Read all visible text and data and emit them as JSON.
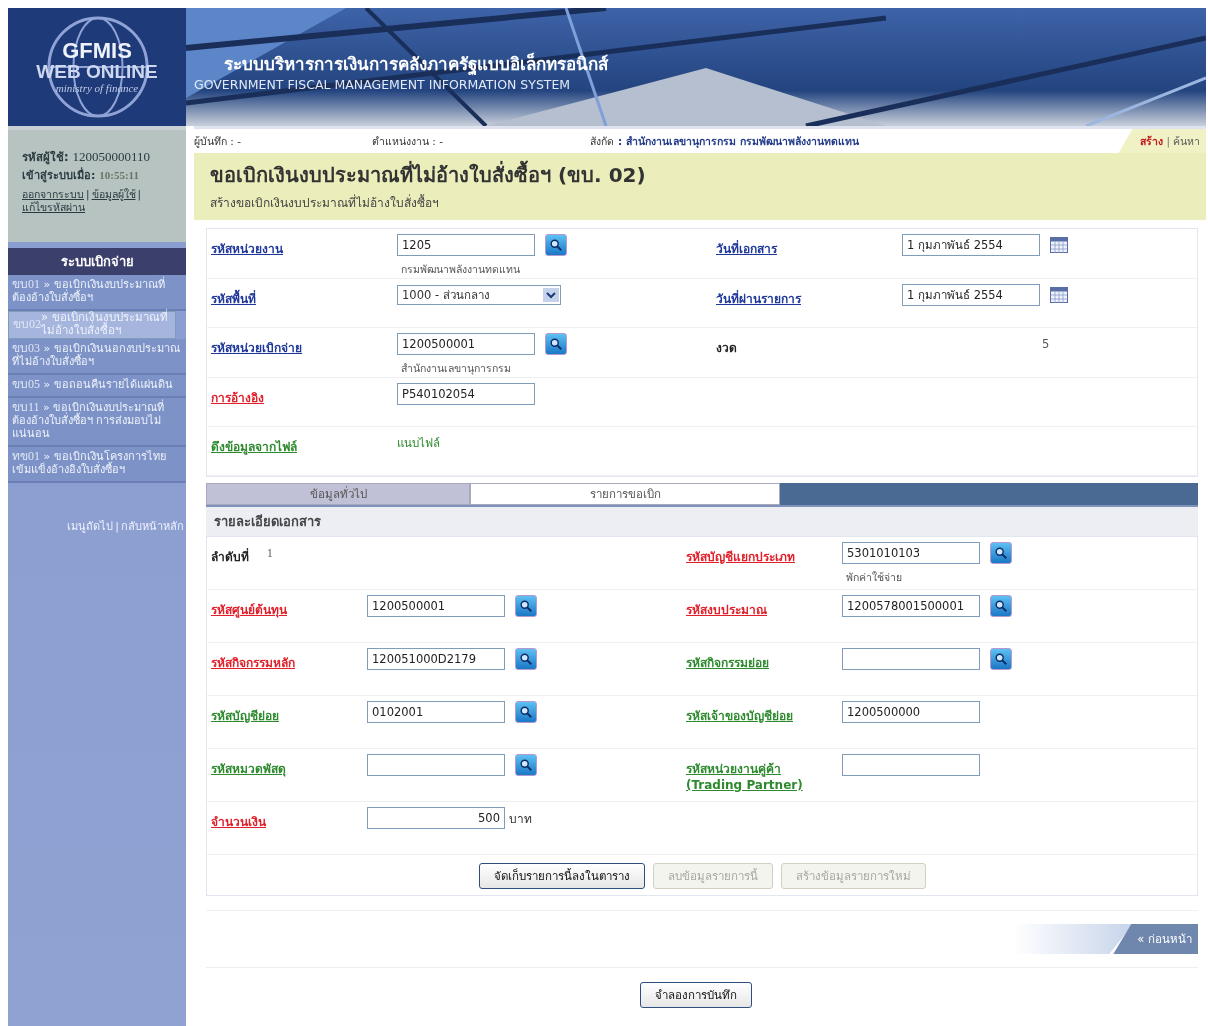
{
  "header": {
    "logo": {
      "line_1": "GFMIS",
      "line_2": "WEB ONLINE",
      "line_3": "ministry of finance"
    },
    "title": "ระบบบริหารการเงินการคลังภาครัฐแบบอิเล็กทรอนิกส์",
    "subtitle": "GOVERNMENT FISCAL MANAGEMENT INFORMATION SYSTEM"
  },
  "user_panel": {
    "user_id_label": "รหัสผู้ใช้:",
    "user_id": "120050000110",
    "login_label": "เข้าสู่ระบบเมื่อ:",
    "login_time": "10:55:11",
    "links": [
      "ออกจากระบบ",
      "ข้อมูลผู้ใช้",
      "แก้ไขรหัสผ่าน"
    ],
    "separator": "|"
  },
  "menu": {
    "title": "ระบบเบิกจ่าย",
    "items": [
      {
        "code": "ขบ01",
        "text": "» ขอเบิกเงินงบประมาณที่ต้องอ้างใบสั่งซื้อฯ",
        "selected": false
      },
      {
        "code": "ขบ02",
        "text": "» ขอเบิกเงินงบประมาณที่ไม่อ้างใบสั่งซื้อฯ",
        "selected": true
      },
      {
        "code": "ขบ03",
        "text": "» ขอเบิกเงินนอกงบประมาณที่ไม่อ้างใบสั่งซื้อฯ",
        "selected": false
      },
      {
        "code": "ขบ05",
        "text": "» ขอถอนคืนรายได้แผ่นดิน",
        "selected": false
      },
      {
        "code": "ขบ11",
        "text": "» ขอเบิกเงินงบประมาณที่ต้องอ้างใบสั่งซื้อฯ การส่งมอบไม่แน่นอน",
        "selected": false
      },
      {
        "code": "ทข01",
        "text": "» ขอเบิกเงินโครงการไทยเข้มแข็งอ้างอิงใบสั่งซื้อฯ",
        "selected": false
      }
    ],
    "footer": [
      "เมนูถัดไป",
      "กลับหน้าหลัก"
    ],
    "separator": "|"
  },
  "info_bar": {
    "recorder": "ผู้บันทึก : -",
    "position": "ตำแหน่งงาน : -",
    "affiliation_label": "สังกัด",
    "affiliation": ": สำนักงานเลขานุการกรม กรมพัฒนาพลังงานทดแทน",
    "modes": [
      {
        "label": "สร้าง",
        "selected": true
      },
      {
        "label": "ค้นหา",
        "selected": false
      }
    ],
    "separator": "|"
  },
  "page": {
    "title": "ขอเบิกเงินงบประมาณที่ไม่อ้างใบสั่งซื้อฯ (ขบ. 02)",
    "subtitle": "สร้างขอเบิกเงินงบประมาณที่ไม่อ้างใบสั่งซื้อฯ"
  },
  "form": {
    "rows": [
      {
        "fields": [
          {
            "label": "รหัสหน่วยงาน",
            "color": "#1e3799",
            "kind": "lookup",
            "value": "1205",
            "note": "กรมพัฒนาพลังงานทดแทน"
          },
          {
            "label": "วันที่เอกสาร",
            "color": "#1e3799",
            "kind": "date",
            "value": "1 กุมภาพันธ์ 2554"
          }
        ]
      },
      {
        "fields": [
          {
            "label": "รหัสพื้นที่",
            "color": "#1e3799",
            "kind": "select",
            "value": "1000 - ส่วนกลาง"
          },
          {
            "label": "วันที่ผ่านรายการ",
            "color": "#1e3799",
            "kind": "date",
            "value": "1 กุมภาพันธ์ 2554"
          }
        ]
      },
      {
        "fields": [
          {
            "label": "รหัสหน่วยเบิกจ่าย",
            "color": "#1e3799",
            "kind": "lookup",
            "value": "1200500001",
            "note": "สำนักงานเลขานุการกรม"
          },
          {
            "label": "งวด",
            "kind": "static",
            "value": "5"
          }
        ]
      },
      {
        "fields": [
          {
            "label": "การอ้างอิง",
            "color": "#e0202a",
            "kind": "text",
            "value": "P540102054"
          }
        ]
      },
      {
        "fields": [
          {
            "label": "ดึงข้อมูลจากไฟล์",
            "color": "#2e8a2e",
            "kind": "file",
            "value": "แนบไฟล์"
          }
        ]
      }
    ]
  },
  "tabs": [
    {
      "label": "ข้อมูลทั่วไป",
      "selected": false
    },
    {
      "label": "รายการขอเบิก",
      "selected": true
    }
  ],
  "detail": {
    "title": "รายละเอียดเอกสาร",
    "rows": [
      {
        "fields": [
          {
            "label": "ลำดับที่",
            "kind": "static",
            "value": "1"
          },
          {
            "label": "รหัสบัญชีแยกประเภท",
            "color": "#e0202a",
            "kind": "lookup",
            "value": "5301010103",
            "note": "พักค่าใช้จ่าย"
          }
        ]
      },
      {
        "fields": [
          {
            "label": "รหัสศูนย์ต้นทุน",
            "color": "#e0202a",
            "kind": "lookup",
            "value": "1200500001"
          },
          {
            "label": "รหัสงบประมาณ",
            "color": "#e0202a",
            "kind": "lookup",
            "value": "1200578001500001"
          }
        ]
      },
      {
        "fields": [
          {
            "label": "รหัสกิจกรรมหลัก",
            "color": "#e0202a",
            "kind": "lookup",
            "value": "120051000D2179"
          },
          {
            "label": "รหัสกิจกรรมย่อย",
            "color": "#2e8a2e",
            "kind": "lookup"
          }
        ]
      },
      {
        "fields": [
          {
            "label": "รหัสบัญชีย่อย",
            "color": "#2e8a2e",
            "kind": "lookup",
            "value": "0102001"
          },
          {
            "label": "รหัสเจ้าของบัญชีย่อย",
            "color": "#2e8a2e",
            "kind": "text",
            "value": "1200500000"
          }
        ]
      },
      {
        "fields": [
          {
            "label": "รหัสหมวดพัสดุ",
            "color": "#2e8a2e",
            "kind": "lookup"
          },
          {
            "label": "รหัสหน่วยงานคู่ค้า",
            "label_2": "(Trading Partner)",
            "color": "#2e8a2e",
            "kind": "text"
          }
        ]
      },
      {
        "fields": [
          {
            "label": "จำนวนเงิน",
            "color": "#e0202a",
            "kind": "amount",
            "value": "500",
            "unit": "บาท"
          }
        ]
      }
    ],
    "buttons": [
      {
        "label": "จัดเก็บรายการนี้ลงในตาราง",
        "disabled": false
      },
      {
        "label": "ลบข้อมูลรายการนี้",
        "disabled": true
      },
      {
        "label": "สร้างข้อมูลรายการใหม่",
        "disabled": true
      }
    ]
  },
  "pager": {
    "previous": "« ก่อนหน้า"
  },
  "footer_button": "จำลองการบันทึก"
}
